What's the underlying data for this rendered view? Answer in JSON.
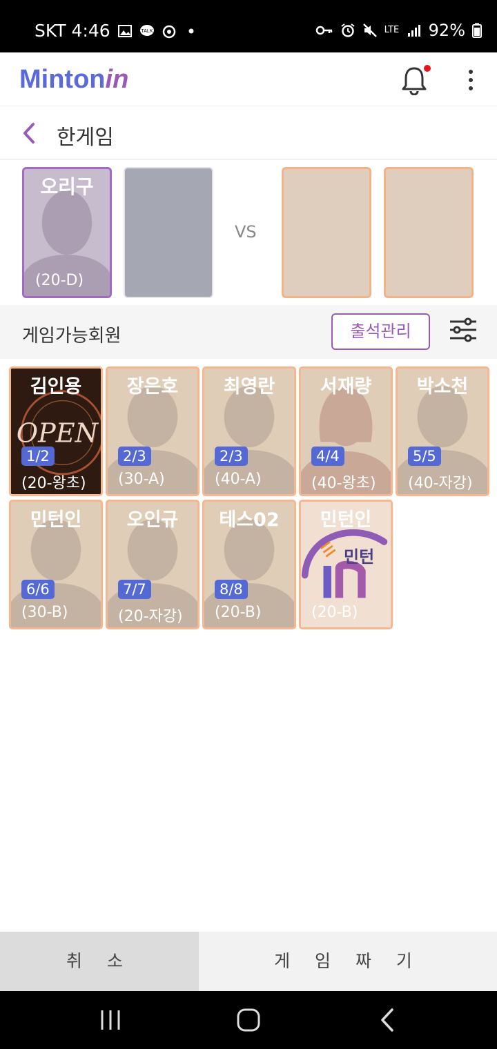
{
  "status_bar": {
    "carrier_time": "SKT 4:46",
    "battery": "92%",
    "network": "LTE"
  },
  "app": {
    "logo_main": "Minton",
    "logo_accent": "in",
    "title": "한게임"
  },
  "court": {
    "vs_label": "VS",
    "me": {
      "name": "오리구",
      "grade": "(20-D)"
    }
  },
  "members_section": {
    "title": "게임가능회원",
    "attendance_button": "출석관리"
  },
  "members": [
    {
      "name": "김인용",
      "count": "1/2",
      "grade": "(20-왕초)",
      "photo": "open-sign"
    },
    {
      "name": "장은호",
      "count": "2/3",
      "grade": "(30-A)"
    },
    {
      "name": "최영란",
      "count": "2/3",
      "grade": "(40-A)"
    },
    {
      "name": "서재량",
      "count": "4/4",
      "grade": "(40-왕초)",
      "avatar": "female"
    },
    {
      "name": "박소천",
      "count": "5/5",
      "grade": "(40-자강)"
    },
    {
      "name": "민턴인",
      "count": "6/6",
      "grade": "(30-B)"
    },
    {
      "name": "오인규",
      "count": "7/7",
      "grade": "(20-자강)"
    },
    {
      "name": "테스02",
      "count": "8/8",
      "grade": "(20-B)"
    },
    {
      "name": "민턴인",
      "count": "",
      "grade": "(20-B)",
      "photo": "minton-logo",
      "logo_text": "민턴",
      "logo_mark": "in"
    }
  ],
  "buttons": {
    "cancel": "취 소",
    "make_game": "게 임 짜 기"
  },
  "colors": {
    "accent_purple": "#9b59b6",
    "brand_blue": "#5a6ad6",
    "card_border": "#f8b58e",
    "count_badge": "#5469d4"
  }
}
